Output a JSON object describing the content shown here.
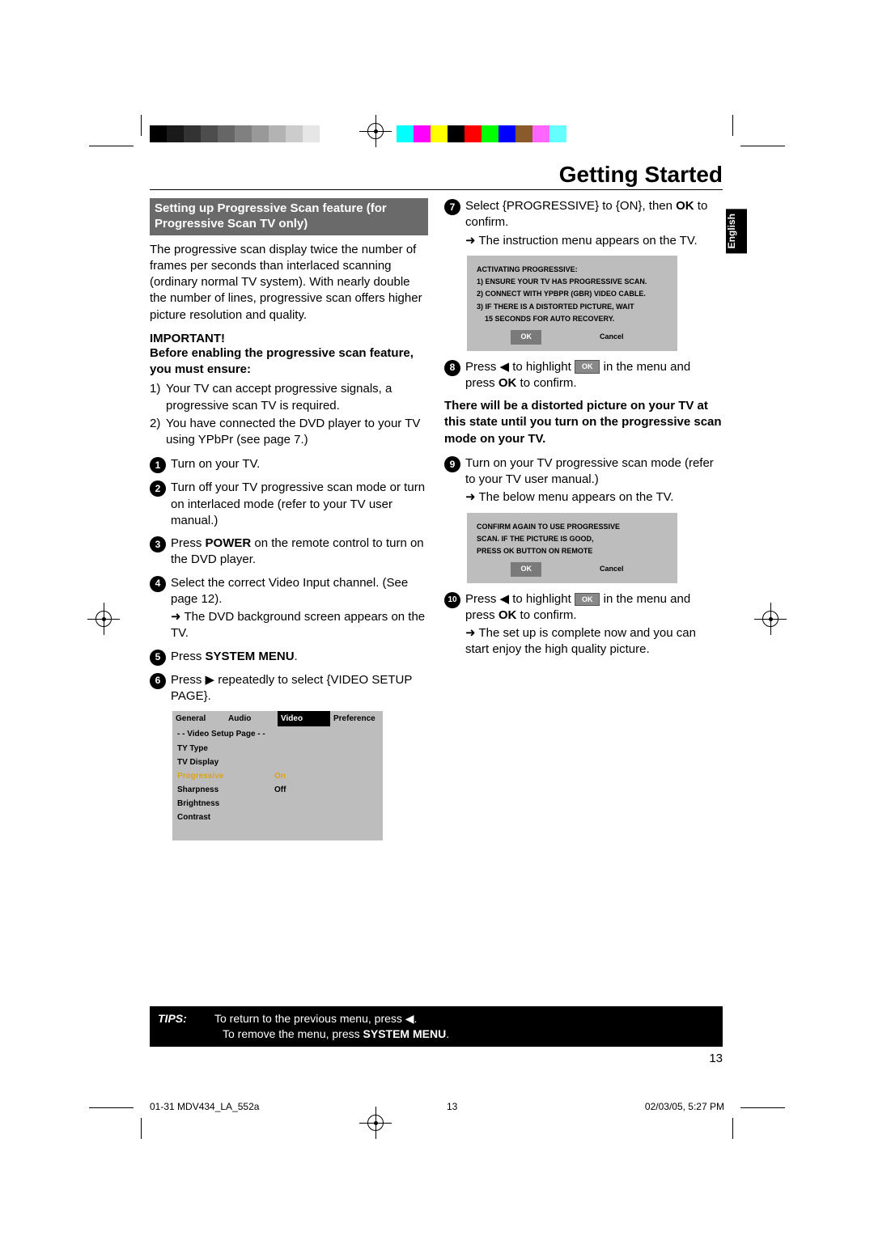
{
  "header": {
    "title": "Getting Started"
  },
  "lang_tab": "English",
  "left": {
    "section_header": "Setting up Progressive Scan feature (for Progressive Scan TV only)",
    "intro": "The progressive scan display twice the number of frames per seconds than interlaced scanning (ordinary normal TV system). With nearly double the number of lines, progressive scan offers higher picture resolution and quality.",
    "important_label": "IMPORTANT!",
    "important_text": "Before enabling the progressive scan feature, you must ensure:",
    "ensure": {
      "n1": "1)",
      "t1": "Your TV can accept progressive signals, a progressive scan TV is required.",
      "n2": "2)",
      "t2": "You have connected the DVD player to your TV using YPbPr (see page 7.)"
    },
    "step1": "Turn on your TV.",
    "step2": "Turn off your TV progressive scan mode or turn on interlaced mode (refer to your TV user manual.)",
    "step3_pre": "Press ",
    "step3_bold": "POWER",
    "step3_post": " on the remote control to turn on the DVD player.",
    "step4_a": "Select the correct Video Input channel. (See page 12).",
    "step4_b": "The DVD background screen appears on the TV.",
    "step5_pre": "Press ",
    "step5_bold": "SYSTEM MENU",
    "step5_post": ".",
    "step6": "Press ▶ repeatedly to select {VIDEO SETUP PAGE}.",
    "osd": {
      "tabs": {
        "general": "General",
        "audio": "Audio",
        "video": "Video",
        "preference": "Preference"
      },
      "subtitle": "- -   Video Setup Page   - -",
      "rows": [
        {
          "label": "TY Type",
          "value": ""
        },
        {
          "label": "TV Display",
          "value": ""
        },
        {
          "label": "Progressive",
          "value": "On",
          "on": true
        },
        {
          "label": "Sharpness",
          "value": "Off"
        },
        {
          "label": "Brightness",
          "value": ""
        },
        {
          "label": "Contrast",
          "value": ""
        }
      ]
    }
  },
  "right": {
    "step7_pre": "Select {PROGRESSIVE} to {ON}, then ",
    "step7_bold": "OK",
    "step7_post": " to confirm.",
    "step7_arrow": "The instruction menu appears on the TV.",
    "dialog1": {
      "l1": "ACTIVATING PROGRESSIVE:",
      "l2": "1) ENSURE YOUR TV HAS PROGRESSIVE SCAN.",
      "l3": "2) CONNECT WITH YPBPR (GBR) VIDEO CABLE.",
      "l4": "3) IF THERE IS A DISTORTED PICTURE, WAIT",
      "l5": "15 SECONDS FOR AUTO RECOVERY.",
      "ok": "OK",
      "cancel": "Cancel"
    },
    "step8_pre": "Press ◀ to highlight ",
    "step8_ok": "OK",
    "step8_mid": " in the menu and press ",
    "step8_bold": "OK",
    "step8_post": " to confirm.",
    "warn": "There will be a distorted picture on your TV at this state until you turn on the progressive scan mode on your TV.",
    "step9": "Turn on your TV progressive scan mode (refer to your TV user manual.)",
    "step9_arrow": "The below menu appears on the TV.",
    "dialog2": {
      "l1": "CONFIRM AGAIN TO USE PROGRESSIVE",
      "l2": "SCAN.  IF THE PICTURE IS GOOD,",
      "l3": "PRESS OK BUTTON ON REMOTE",
      "ok": "OK",
      "cancel": "Cancel"
    },
    "step10_pre": "Press ◀ to highlight ",
    "step10_ok": "OK",
    "step10_mid": " in the menu and press ",
    "step10_bold": "OK",
    "step10_post": " to confirm.",
    "step10_arrow": "The set up is complete now and you can start enjoy the high quality picture."
  },
  "tips": {
    "label": "TIPS:",
    "line1": "To return to the previous menu, press ◀.",
    "line2_pre": "To remove the menu, press ",
    "line2_bold": "SYSTEM MENU",
    "line2_post": "."
  },
  "page_number": "13",
  "footer": {
    "file": "01-31 MDV434_LA_552a",
    "pg": "13",
    "date": "02/03/05, 5:27 PM"
  },
  "swatches_left": [
    "#000000",
    "#1a1a1a",
    "#333333",
    "#4d4d4d",
    "#666666",
    "#808080",
    "#999999",
    "#b3b3b3",
    "#cccccc",
    "#e6e6e6",
    "#ffffff"
  ],
  "swatches_right": [
    "#00ffff",
    "#ff00ff",
    "#ffff00",
    "#000000",
    "#ff0000",
    "#00ff00",
    "#0000ff",
    "#8b5a2b",
    "#ff66ff",
    "#66ffff",
    "#ffffff",
    "#ffffff"
  ]
}
